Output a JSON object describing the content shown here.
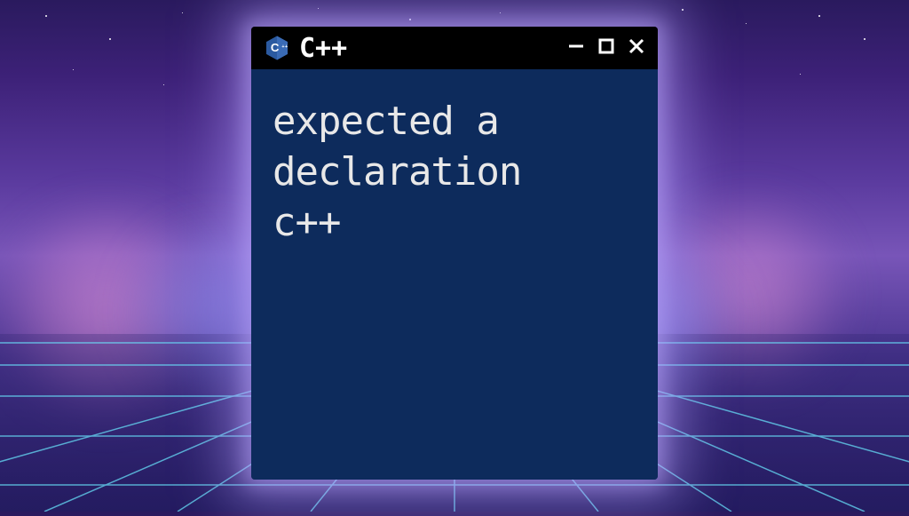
{
  "window": {
    "title": "C++",
    "icon_name": "cpp-hexagon-icon",
    "body_text": "expected a\ndeclaration\nc++"
  },
  "colors": {
    "titlebar_bg": "#000000",
    "window_body_bg": "#0d2b5c",
    "text_color": "#e8e8e8",
    "glow_color": "#b8a0ff"
  }
}
